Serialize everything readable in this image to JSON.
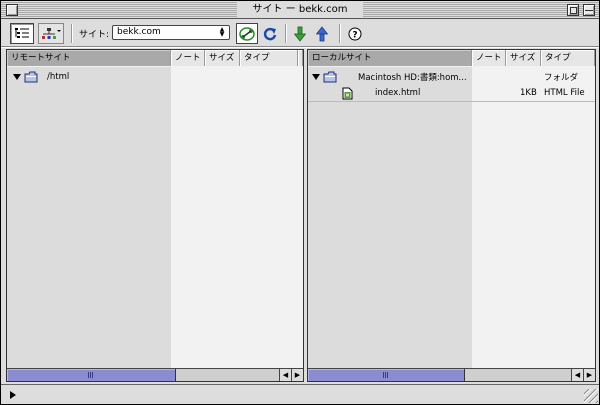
{
  "window": {
    "title": "サイト ー bekk.com"
  },
  "toolbar": {
    "site_label": "サイト:",
    "site_value": "bekk.com",
    "buttons": [
      "list-view-icon",
      "site-map-icon",
      "connect-icon",
      "refresh-icon",
      "get-icon",
      "put-icon",
      "help-icon"
    ],
    "help_glyph": "?"
  },
  "remote": {
    "headers": {
      "name": "リモートサイト",
      "note": "ノート",
      "size": "サイズ",
      "type": "タイプ"
    },
    "rows": [
      {
        "name": "/html",
        "kind": "folder",
        "expanded": true
      }
    ]
  },
  "local": {
    "headers": {
      "name": "ローカルサイト",
      "note": "ノート",
      "size": "サイズ",
      "type": "タイプ"
    },
    "rows": [
      {
        "name": "Macintosh HD:書類:hom...",
        "size": "",
        "type": "フォルダ",
        "kind": "folder",
        "expanded": true
      },
      {
        "name": "index.html",
        "size": "1KB",
        "type": "HTML File",
        "kind": "file"
      }
    ]
  },
  "colors": {
    "scroll_thumb": "#8b8bd0",
    "sorted_header": "#a9a9a9"
  }
}
